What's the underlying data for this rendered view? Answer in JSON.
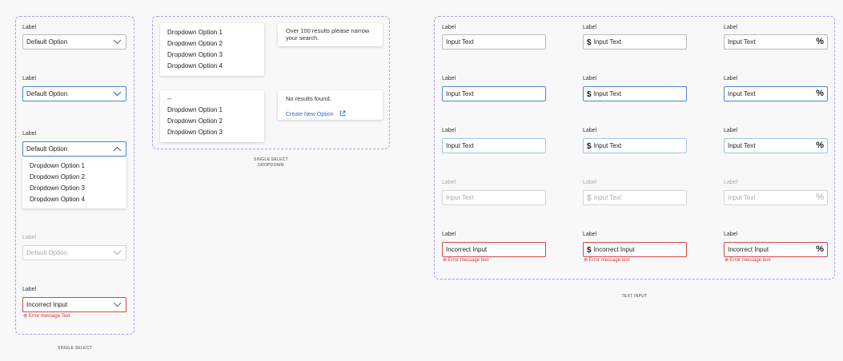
{
  "single_select": {
    "caption": "SINGLE SELECT",
    "fields": [
      {
        "label": "Label",
        "value": "Default Option",
        "state": "default"
      },
      {
        "label": "Label",
        "value": "Default Option",
        "state": "focus"
      },
      {
        "label": "Label",
        "value": "Default Option",
        "state": "open"
      },
      {
        "label": "Label",
        "value": "Default Option",
        "state": "disabled"
      },
      {
        "label": "Label",
        "value": "Incorrect Input",
        "state": "error"
      }
    ],
    "open_options": [
      "Dropdown Option 1",
      "Dropdown Option 2",
      "Dropdown Option 3",
      "Dropdown Option 4"
    ],
    "error_message": "⊗ Error message Text"
  },
  "dropdown": {
    "caption_line1": "SINGLE SELECT",
    "caption_line2": "DROPDOWN",
    "list1": [
      "Dropdown Option 1",
      "Dropdown Option 2",
      "Dropdown Option 3",
      "Dropdown Option 4"
    ],
    "list2": [
      "--",
      "Dropdown Option 1",
      "Dropdown Option 2",
      "Dropdown Option 3"
    ],
    "over_limit_message": "Over 100 results please narrow your search.",
    "no_results_message": "No results found.",
    "create_link": "Create New Option"
  },
  "text_input": {
    "caption": "TEXT INPUT",
    "rows": [
      {
        "label": "Label",
        "value": "Input Text",
        "state": "default"
      },
      {
        "label": "Label",
        "value": "Input Text",
        "state": "focus"
      },
      {
        "label": "Label",
        "value": "Input Text",
        "state": "hover"
      },
      {
        "label": "Label",
        "value": "Input Text",
        "state": "disabled"
      },
      {
        "label": "Label",
        "value": "Incorrect Input",
        "state": "error"
      }
    ],
    "prefix_symbol": "$",
    "suffix_symbol": "%",
    "error_message": "⊗ Error message text"
  },
  "colors": {
    "accent": "#4f84d6",
    "error": "#d64545",
    "frame": "#a99cf2"
  }
}
